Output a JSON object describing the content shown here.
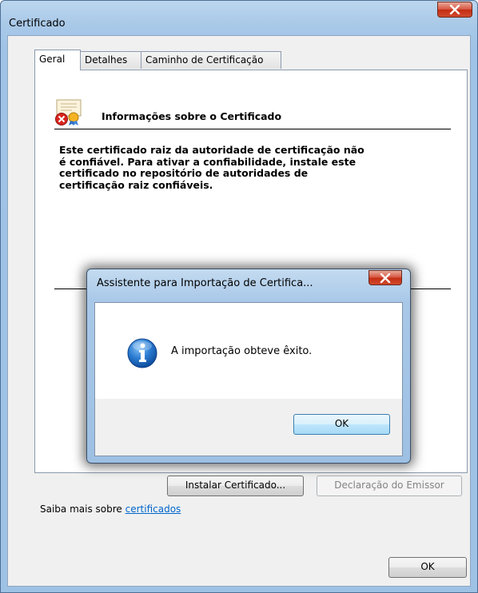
{
  "window": {
    "title": "Certificado"
  },
  "tabs": [
    {
      "label": "Geral",
      "active": true
    },
    {
      "label": "Detalhes",
      "active": false
    },
    {
      "label": "Caminho de Certificação",
      "active": false
    }
  ],
  "cert_info": {
    "heading": "Informações sobre o Certificado",
    "body_lines": [
      "Este certificado raiz da autoridade de certificação não",
      "é confiável. Para ativar a confiabilidade, instale este",
      "certificado no repositório de autoridades de",
      "certificação raiz confiáveis."
    ]
  },
  "buttons": {
    "install": "Instalar Certificado...",
    "issuer_statement": "Declaração do Emissor",
    "ok": "OK"
  },
  "learn_more": {
    "prefix": "Saiba mais sobre ",
    "link": "certificados"
  },
  "dialog": {
    "title": "Assistente para Importação de Certifica...",
    "message": "A importação obteve êxito.",
    "ok": "OK",
    "icon": "info-icon"
  },
  "icons": {
    "close": "close-icon",
    "certificate": "certificate-error-icon"
  },
  "colors": {
    "link": "#0066cc",
    "close_button": "#c42d12",
    "info_icon": "#1c64b8"
  }
}
